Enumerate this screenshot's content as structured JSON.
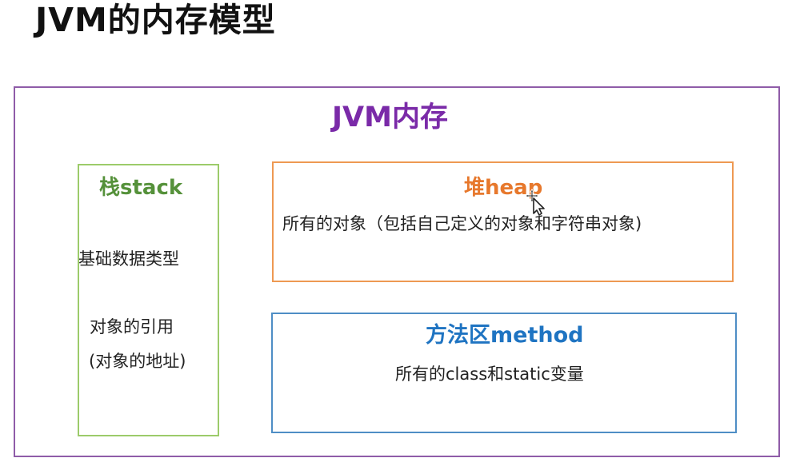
{
  "slide": {
    "title": "JVM的内存模型"
  },
  "diagram": {
    "outer_title": "JVM内存",
    "stack": {
      "title": "栈stack",
      "line1": "基础数据类型",
      "line2": "对象的引用",
      "line3": "(对象的地址)"
    },
    "heap": {
      "title": "堆heap",
      "description": "所有的对象（包括自己定义的对象和字符串对象)"
    },
    "method": {
      "title": "方法区method",
      "description": "所有的class和static变量"
    }
  },
  "colors": {
    "outer_border": "#8f5ca8",
    "outer_title": "#7a2aa8",
    "stack_border": "#9ccb6a",
    "stack_title": "#55913a",
    "heap_border": "#ee9952",
    "heap_title": "#e7782c",
    "method_border": "#4e8ec5",
    "method_title": "#1f74c2"
  },
  "icons": {
    "cursor": "move-cursor-icon"
  }
}
